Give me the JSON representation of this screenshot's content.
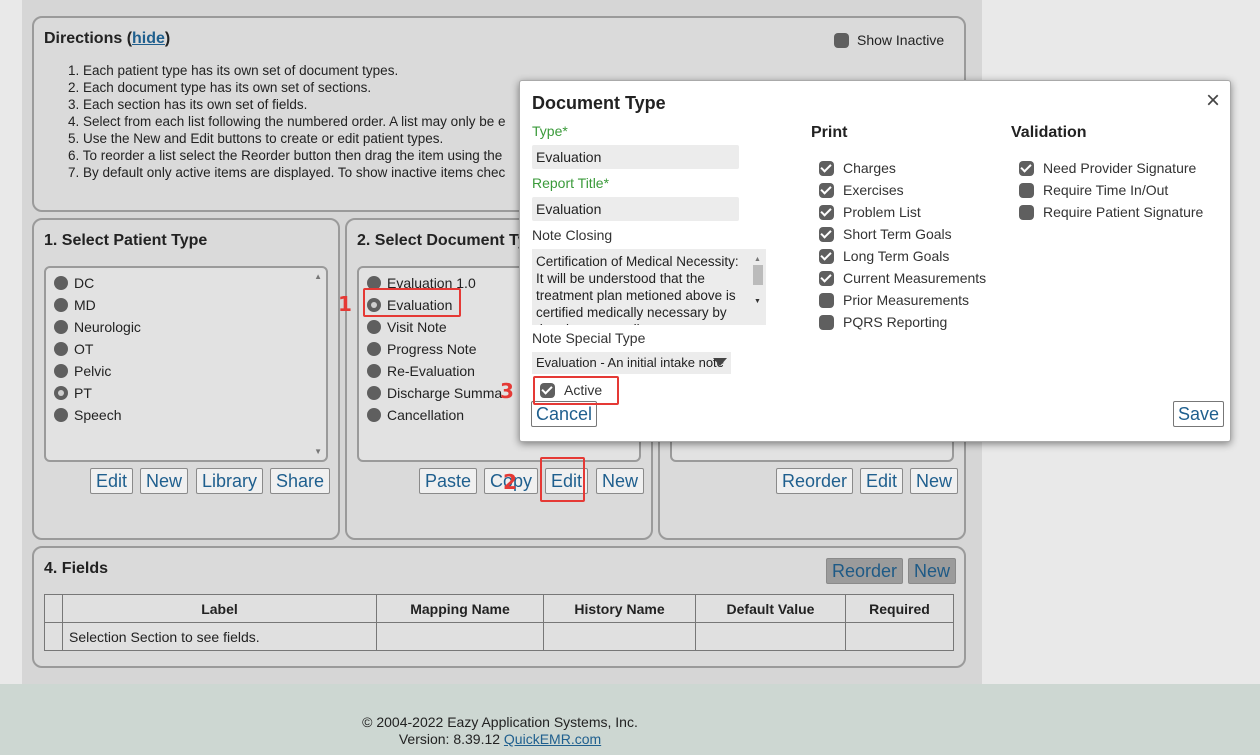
{
  "directions": {
    "title": "Directions",
    "hide_link": "hide",
    "show_inactive": "Show Inactive",
    "items": [
      "1. Each patient type has its own set of document types.",
      "2. Each document type has its own set of sections.",
      "3. Each section has its own set of fields.",
      "4. Select from each list following the numbered order. A list may only be e",
      "5. Use the New and Edit buttons to create or edit patient types.",
      "6. To reorder a list select the Reorder button then drag the item using the",
      "7. By default only active items are displayed. To show inactive items chec"
    ]
  },
  "patient_type": {
    "title": "1. Select Patient Type",
    "items": [
      "DC",
      "MD",
      "Neurologic",
      "OT",
      "Pelvic",
      "PT",
      "Speech"
    ],
    "selected": "PT",
    "buttons": [
      "Edit",
      "New",
      "Library",
      "Share"
    ]
  },
  "document_type": {
    "title": "2. Select Document Ty",
    "items": [
      "Evaluation 1.0",
      "Evaluation",
      "Visit Note",
      "Progress Note",
      "Re-Evaluation",
      "Discharge Summa",
      "Cancellation"
    ],
    "selected": "Evaluation",
    "buttons": [
      "Paste",
      "Copy",
      "Edit",
      "New"
    ]
  },
  "section": {
    "buttons": [
      "Reorder",
      "Edit",
      "New"
    ]
  },
  "fields": {
    "title": "4. Fields",
    "buttons": [
      "Reorder",
      "New"
    ],
    "columns": [
      "Label",
      "Mapping Name",
      "History Name",
      "Default Value",
      "Required"
    ],
    "empty_text": "Selection Section to see fields."
  },
  "callouts": [
    "1",
    "2",
    "3"
  ],
  "modal": {
    "title": "Document Type",
    "close": "×",
    "type_label": "Type*",
    "type_value": "Evaluation",
    "report_title_label": "Report Title*",
    "report_title_value": "Evaluation",
    "note_closing_label": "Note Closing",
    "note_closing_value": "Certification of Medical Necessity: It will be understood that the treatment plan metioned above is certified medically necessary by the above attending",
    "note_special_type_label": "Note Special Type",
    "note_special_type_value": "Evaluation - An initial intake note",
    "active_label": "Active",
    "active_checked": true,
    "print_header": "Print",
    "print_items": [
      {
        "label": "Charges",
        "checked": true
      },
      {
        "label": "Exercises",
        "checked": true
      },
      {
        "label": "Problem List",
        "checked": true
      },
      {
        "label": "Short Term Goals",
        "checked": true
      },
      {
        "label": "Long Term Goals",
        "checked": true
      },
      {
        "label": "Current Measurements",
        "checked": true
      },
      {
        "label": "Prior Measurements",
        "checked": false
      },
      {
        "label": "PQRS Reporting",
        "checked": false
      }
    ],
    "validation_header": "Validation",
    "validation_items": [
      {
        "label": "Need Provider Signature",
        "checked": true
      },
      {
        "label": "Require Time In/Out",
        "checked": false
      },
      {
        "label": "Require Patient Signature",
        "checked": false
      }
    ],
    "cancel": "Cancel",
    "save": "Save"
  },
  "footer": {
    "copyright": "© 2004-2022 Eazy Application Systems, Inc.",
    "version_prefix": "Version: 8.39.12 ",
    "version_link": "QuickEMR.com"
  },
  "colors": {
    "accent_link": "#1f5f8e",
    "required_label": "#3a9a3a",
    "callout_red": "#e53935"
  }
}
